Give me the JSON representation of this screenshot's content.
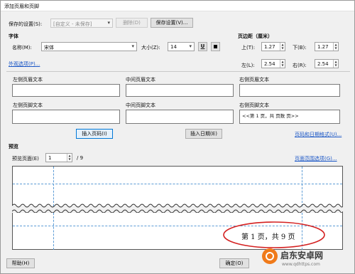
{
  "window": {
    "title": "添加页眉和页脚"
  },
  "saved_settings": {
    "label": "保存的设置(S):",
    "value": "[自定义 - 未保存]",
    "delete_button": "删除(D)",
    "save_button": "保存设置(V)..."
  },
  "font": {
    "section_label": "字体",
    "name_label": "名称(M):",
    "name_value": "宋体",
    "size_label": "大小(Z):",
    "size_value": "14",
    "underline_glyph": "U",
    "appearance_link": "外观选项(P)..."
  },
  "margins": {
    "section_label": "页边距（厘米）",
    "top_label": "上(T):",
    "top_value": "1.27",
    "bottom_label": "下(B):",
    "bottom_value": "1.27",
    "left_label": "左(L):",
    "left_value": "2.54",
    "right_label": "右(R):",
    "right_value": "2.54"
  },
  "header_footer": {
    "left_header": "左侧页眉文本",
    "center_header": "中间页眉文本",
    "right_header": "右侧页眉文本",
    "left_footer": "左侧页脚文本",
    "center_footer": "中间页脚文本",
    "right_footer": "右侧页脚文本",
    "right_footer_value": "<<第 1 页，共 页数 页>>"
  },
  "insert": {
    "page_number_button": "插入页码(I)",
    "date_button": "插入日期(E)",
    "page_format_link": "页码和日期格式(U)..."
  },
  "preview": {
    "section_label": "预览",
    "page_label": "预览页面(E)",
    "page_value": "1",
    "total_pages": "/ 9",
    "page_range_link": "页面范围选项(G)...",
    "footer_sample": "第 1 页，共 9 页"
  },
  "footer_buttons": {
    "help": "帮助(H)",
    "ok": "确定(O)"
  },
  "watermark": {
    "brand": "启东安卓网",
    "url": "www.qdhttps.com"
  }
}
